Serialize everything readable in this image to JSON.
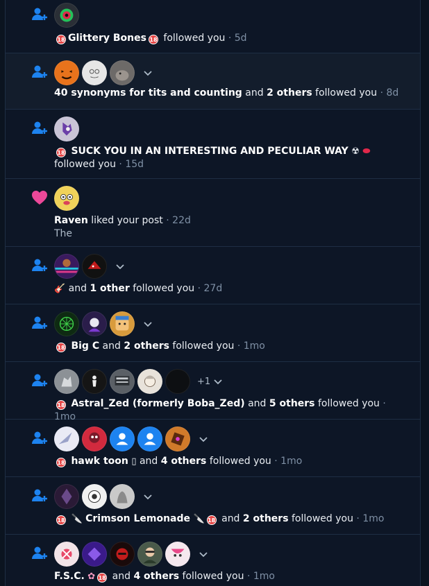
{
  "notifications": [
    {
      "name": "Glittery Bones",
      "action": "followed you",
      "time": "5d"
    },
    {
      "name": "40 synonyms for tits and counting",
      "connector": "and",
      "others": "2 others",
      "action": "followed you",
      "time": "8d"
    },
    {
      "name": "SUCK YOU IN AN INTERESTING AND PECULIAR WAY",
      "action": "followed you",
      "time": "15d"
    },
    {
      "name": "Raven",
      "action": "liked your post",
      "time": "22d",
      "preview": "The"
    },
    {
      "connector": "and",
      "others": "1 other",
      "action": "followed you",
      "time": "27d"
    },
    {
      "name": "Big C",
      "connector": "and",
      "others": "2 others",
      "action": "followed you",
      "time": "1mo"
    },
    {
      "name": "Astral_Zed (formerly Boba_Zed)",
      "connector": "and",
      "others": "5 others",
      "action": "followed you",
      "time": "1mo",
      "more": "+1"
    },
    {
      "name": "hawk toon",
      "connector": "and",
      "others": "4 others",
      "action": "followed you",
      "time": "1mo"
    },
    {
      "name": "Crimson Lemonade",
      "connector": "and",
      "others": "2 others",
      "action": "followed you",
      "time": "1mo"
    },
    {
      "name": "F.S.C.",
      "connector": "and",
      "others": "4 others",
      "action": "followed you",
      "time": "1mo"
    }
  ],
  "separator": "·",
  "adult_badge": "18",
  "icons": {
    "follow": "person-plus-icon",
    "like": "heart-icon",
    "expand": "chevron-down-icon"
  },
  "colors": {
    "background": "#0d1626",
    "follow_icon": "#1d83f0",
    "like_icon": "#ec4899",
    "muted": "#7f90a5",
    "divider": "#1e2e44"
  }
}
